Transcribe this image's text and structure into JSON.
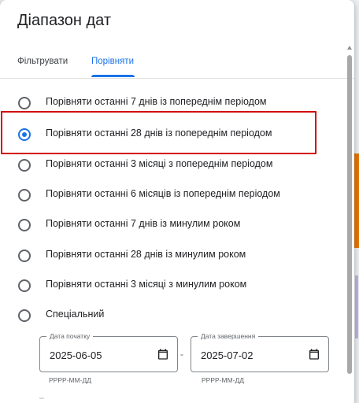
{
  "dialog": {
    "title": "Діапазон дат",
    "tabs": [
      {
        "label": "Фільтрувати",
        "active": false
      },
      {
        "label": "Порівняти",
        "active": true
      }
    ],
    "options": [
      {
        "label": "Порівняти останні 7 днів із попереднім періодом",
        "checked": false
      },
      {
        "label": "Порівняти останні 28 днів із попереднім періодом",
        "checked": true
      },
      {
        "label": "Порівняти останні 3 місяці з попереднім періодом",
        "checked": false
      },
      {
        "label": "Порівняти останні 6 місяців із попереднім періодом",
        "checked": false
      },
      {
        "label": "Порівняти останні 7 днів із минулим роком",
        "checked": false
      },
      {
        "label": "Порівняти останні 28 днів із минулим роком",
        "checked": false
      },
      {
        "label": "Порівняти останні 3 місяці з минулим роком",
        "checked": false
      },
      {
        "label": "Спеціальний",
        "checked": false
      }
    ],
    "start_date": {
      "label": "Дата початку",
      "value": "2025-06-05",
      "hint": "РРРР-ММ-ДД"
    },
    "end_date": {
      "label": "Дата завершення",
      "value": "2025-07-02",
      "hint": "РРРР-ММ-ДД"
    },
    "separator": "-"
  },
  "colors": {
    "accent": "#1a73e8",
    "highlight": "#d40000",
    "text": "#202124"
  },
  "icons": [
    "calendar-icon",
    "scroll-up-icon"
  ]
}
